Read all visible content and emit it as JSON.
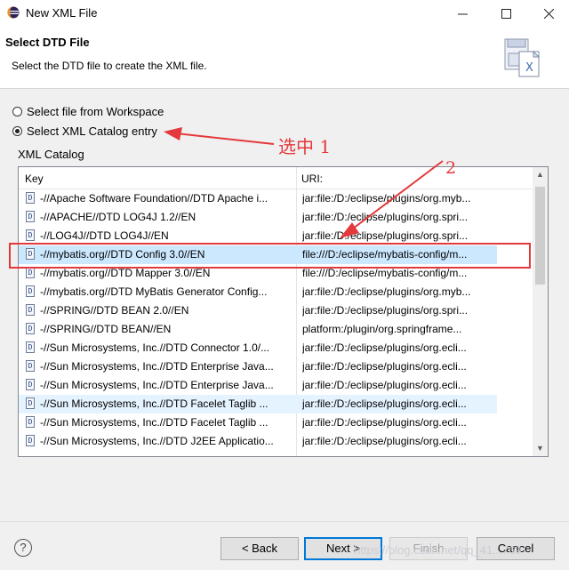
{
  "window": {
    "title": "New XML File"
  },
  "header": {
    "title": "Select DTD File",
    "description": "Select the DTD file to create the XML file."
  },
  "options": {
    "workspace_label": "Select file from Workspace",
    "catalog_label": "Select XML Catalog entry",
    "selected": "catalog"
  },
  "catalog": {
    "group_label": "XML Catalog",
    "columns": [
      "Key",
      "URI:"
    ],
    "rows": [
      {
        "key": "-//Apache Software Foundation//DTD Apache i...",
        "uri": "jar:file:/D:/eclipse/plugins/org.myb..."
      },
      {
        "key": "-//APACHE//DTD LOG4J 1.2//EN",
        "uri": "jar:file:/D:/eclipse/plugins/org.spri..."
      },
      {
        "key": "-//LOG4J//DTD LOG4J//EN",
        "uri": "jar:file:/D:/eclipse/plugins/org.spri..."
      },
      {
        "key": "-//mybatis.org//DTD Config 3.0//EN",
        "uri": "file:///D:/eclipse/mybatis-config/m..."
      },
      {
        "key": "-//mybatis.org//DTD Mapper 3.0//EN",
        "uri": "file:///D:/eclipse/mybatis-config/m..."
      },
      {
        "key": "-//mybatis.org//DTD MyBatis Generator Config...",
        "uri": "jar:file:/D:/eclipse/plugins/org.myb..."
      },
      {
        "key": "-//SPRING//DTD BEAN 2.0//EN",
        "uri": "jar:file:/D:/eclipse/plugins/org.spri..."
      },
      {
        "key": "-//SPRING//DTD BEAN//EN",
        "uri": "platform:/plugin/org.springframe..."
      },
      {
        "key": "-//Sun Microsystems, Inc.//DTD Connector 1.0/...",
        "uri": "jar:file:/D:/eclipse/plugins/org.ecli..."
      },
      {
        "key": "-//Sun Microsystems, Inc.//DTD Enterprise Java...",
        "uri": "jar:file:/D:/eclipse/plugins/org.ecli..."
      },
      {
        "key": "-//Sun Microsystems, Inc.//DTD Enterprise Java...",
        "uri": "jar:file:/D:/eclipse/plugins/org.ecli..."
      },
      {
        "key": "-//Sun Microsystems, Inc.//DTD Facelet Taglib ...",
        "uri": "jar:file:/D:/eclipse/plugins/org.ecli..."
      },
      {
        "key": "-//Sun Microsystems, Inc.//DTD Facelet Taglib ...",
        "uri": "jar:file:/D:/eclipse/plugins/org.ecli..."
      },
      {
        "key": "-//Sun Microsystems, Inc.//DTD J2EE Applicatio...",
        "uri": "jar:file:/D:/eclipse/plugins/org.ecli..."
      }
    ],
    "selected_row": 3,
    "hovered_row": 11
  },
  "annotations": {
    "note_1": "选中 1",
    "note_2": "2",
    "color": "#e4393c"
  },
  "footer": {
    "back_label": "< Back",
    "next_label": "Next >",
    "finish_label": "Finish",
    "cancel_label": "Cancel"
  },
  "watermark": "https://blog.csdn.net/qq_41...769"
}
